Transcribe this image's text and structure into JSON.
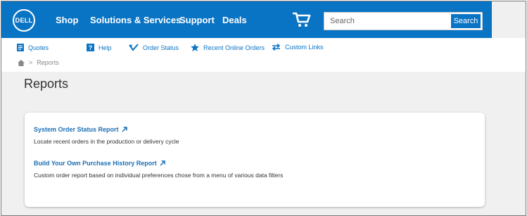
{
  "header": {
    "logo_text": "DELL",
    "nav": [
      {
        "label": "Shop"
      },
      {
        "label": "Solutions & Services"
      },
      {
        "label": "Support"
      },
      {
        "label": "Deals"
      }
    ],
    "cart_icon": "cart-icon",
    "search": {
      "placeholder": "Search",
      "value": "",
      "button_label": "Search"
    },
    "brand_color": "#0a74c4"
  },
  "subnav": {
    "items": [
      {
        "label": "Quotes",
        "icon": "document-icon"
      },
      {
        "label": "Help",
        "icon": "help-icon"
      },
      {
        "label": "Order Status",
        "icon": "truck-icon"
      },
      {
        "label": "Recent Online Orders",
        "icon": "star-icon"
      },
      {
        "label": "Custom Links",
        "icon": "arrows-icon"
      }
    ]
  },
  "breadcrumb": {
    "home_icon": "home-icon",
    "separator": ">",
    "current": "Reports"
  },
  "page": {
    "title": "Reports",
    "reports": [
      {
        "title": "System Order Status Report",
        "description": "Locate recent orders in the production or delivery cycle"
      },
      {
        "title": "Build Your Own Purchase History Report",
        "description": "Custom order report based on individual preferences chose from a menu of various data filters"
      }
    ]
  }
}
